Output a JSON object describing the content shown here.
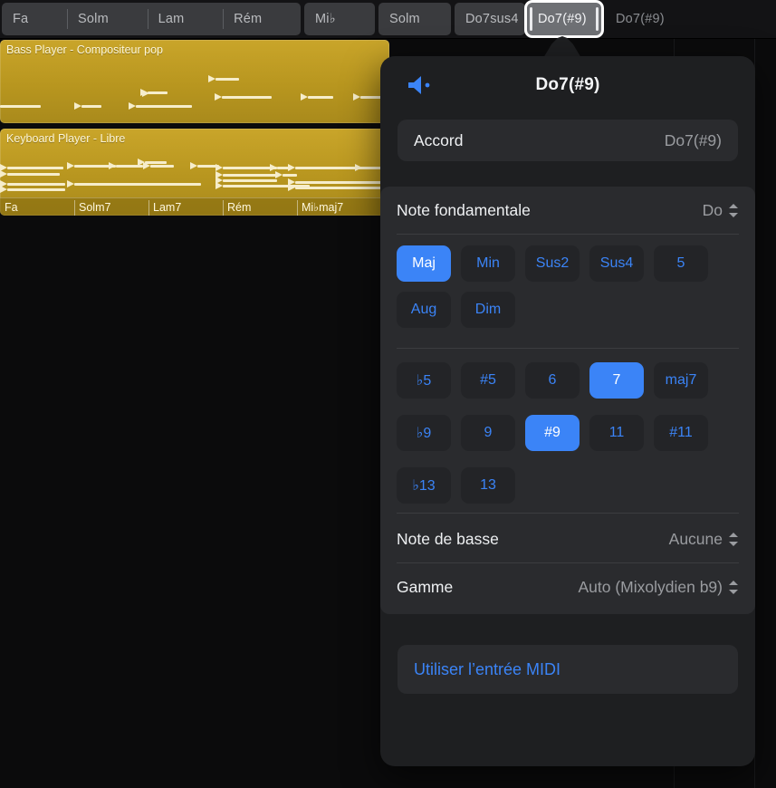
{
  "chord_track": {
    "cells": [
      {
        "labels": [
          "Fa",
          "Solm",
          "Lam",
          "Rém"
        ],
        "state": "normal"
      },
      {
        "labels": [
          "Mi♭"
        ],
        "state": "normal"
      },
      {
        "labels": [
          "Solm"
        ],
        "state": "normal"
      },
      {
        "labels": [
          "Do7sus4"
        ],
        "state": "normal"
      },
      {
        "labels": [
          "Do7(#9)"
        ],
        "state": "selected"
      },
      {
        "labels": [
          "Do7(#9)"
        ],
        "state": "ghost"
      }
    ]
  },
  "regions": [
    {
      "title": "Bass Player - Compositeur pop"
    },
    {
      "title": "Keyboard Player - Libre",
      "chord_labels": [
        "Fa",
        "Solm7",
        "Lam7",
        "Rém",
        "Mi♭maj7"
      ]
    }
  ],
  "popover": {
    "speaker_icon": "speaker-audition-icon",
    "title": "Do7(#9)",
    "accord": {
      "label": "Accord",
      "value": "Do7(#9)"
    },
    "root_note": {
      "label": "Note fondamentale",
      "value": "Do"
    },
    "quality_rows": [
      [
        {
          "label": "Maj",
          "active": true
        },
        {
          "label": "Min",
          "active": false
        },
        {
          "label": "Sus2",
          "active": false
        },
        {
          "label": "Sus4",
          "active": false
        },
        {
          "label": "5",
          "active": false
        }
      ],
      [
        {
          "label": "Aug",
          "active": false
        },
        {
          "label": "Dim",
          "active": false
        }
      ],
      [
        {
          "label": "♭5",
          "active": false
        },
        {
          "label": "#5",
          "active": false
        },
        {
          "label": "6",
          "active": false
        },
        {
          "label": "7",
          "active": true
        },
        {
          "label": "maj7",
          "active": false
        }
      ],
      [
        {
          "label": "♭9",
          "active": false
        },
        {
          "label": "9",
          "active": false
        },
        {
          "label": "#9",
          "active": true
        },
        {
          "label": "11",
          "active": false
        },
        {
          "label": "#11",
          "active": false
        }
      ],
      [
        {
          "label": "♭13",
          "active": false
        },
        {
          "label": "13",
          "active": false
        }
      ]
    ],
    "bass_note": {
      "label": "Note de basse",
      "value": "Aucune"
    },
    "scale": {
      "label": "Gamme",
      "value": "Auto (Mixolydien b9)"
    },
    "midi_button": {
      "label": "Utiliser l’entrée MIDI"
    }
  },
  "colors": {
    "accent_blue": "#3b84f7",
    "region_gold": "#b8961f",
    "popover_bg": "#1e1f21",
    "card_bg": "#2a2b2e",
    "button_bg": "#232427"
  }
}
